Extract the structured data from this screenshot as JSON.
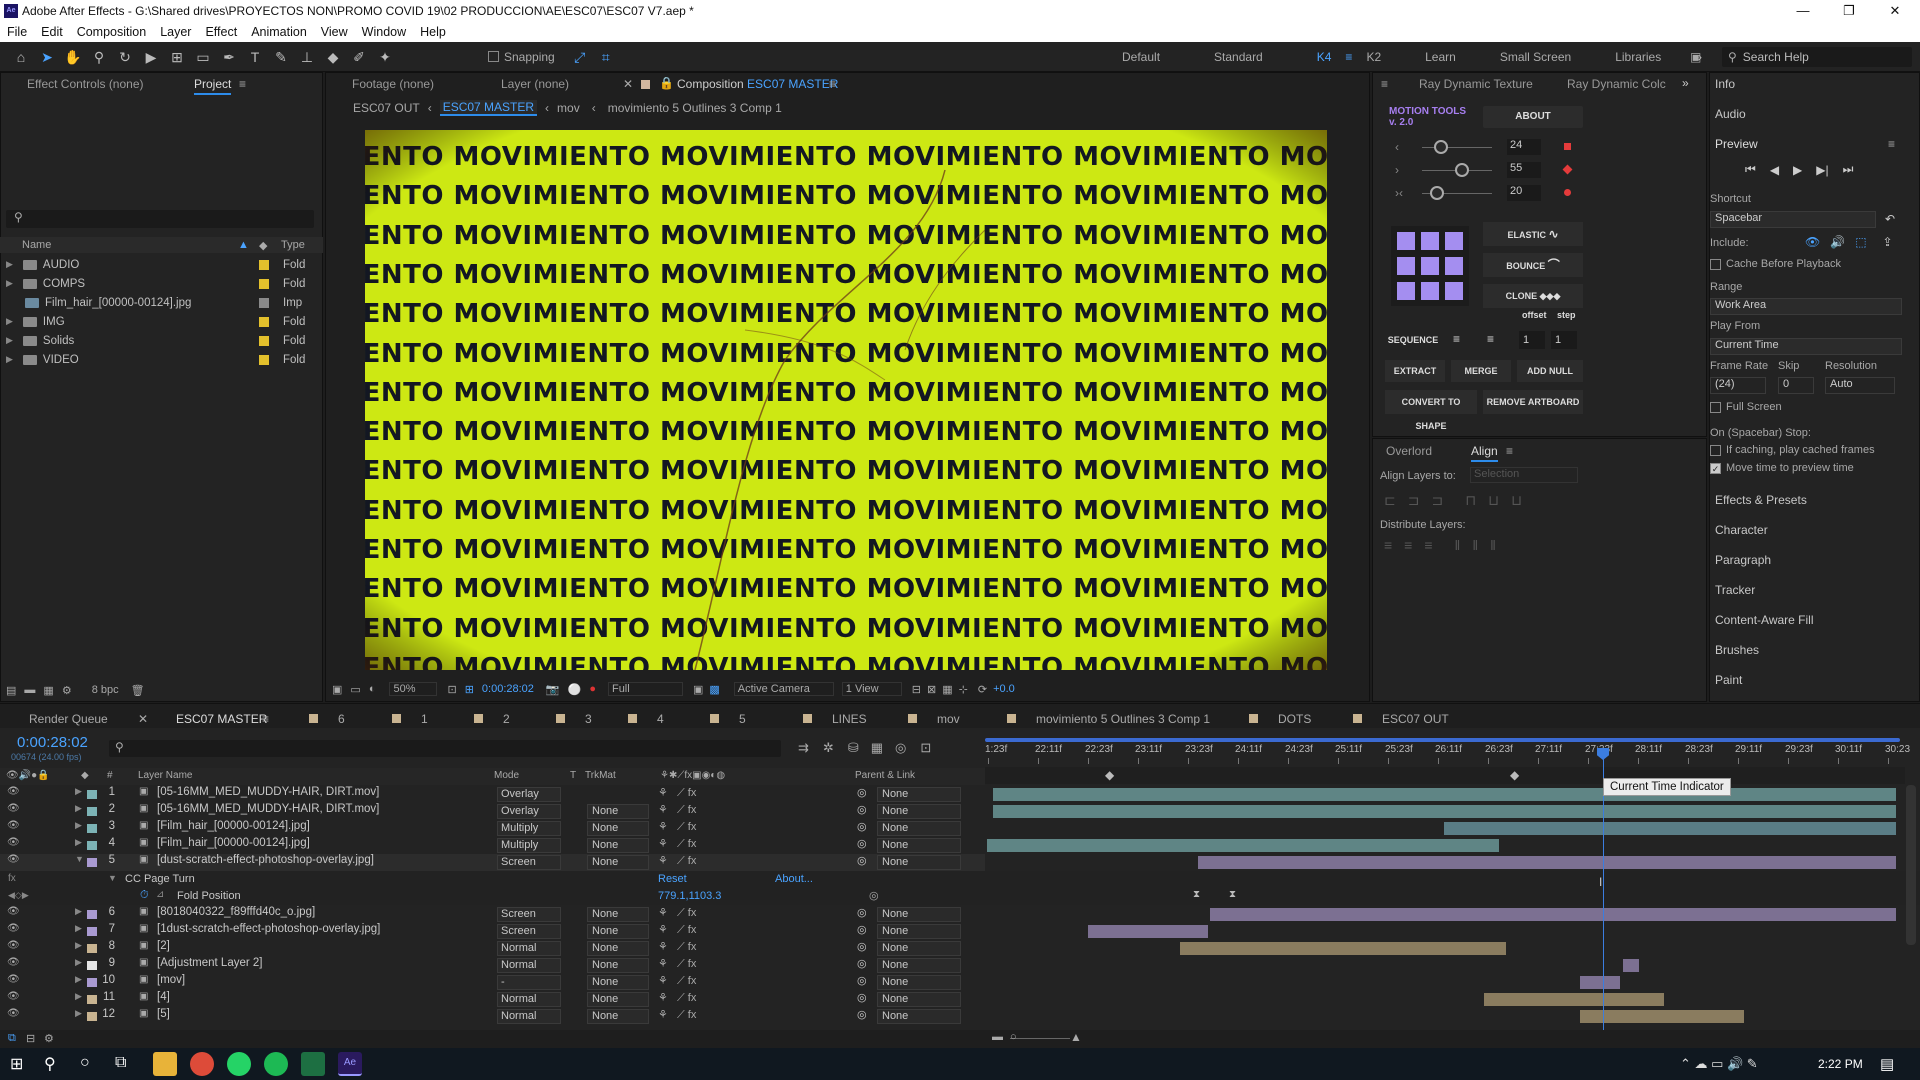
{
  "titlebar": {
    "title": "Adobe After Effects - G:\\Shared drives\\PROYECTOS NON\\PROMO COVID 19\\02 PRODUCCION\\AE\\ESC07\\ESC07 V7.aep *",
    "logo": "Ae"
  },
  "menu": [
    "File",
    "Edit",
    "Composition",
    "Layer",
    "Effect",
    "Animation",
    "View",
    "Window",
    "Help"
  ],
  "toolbar": {
    "snapping": "Snapping",
    "workspaces": [
      "Default",
      "Standard",
      "K4",
      "K2",
      "Learn",
      "Small Screen",
      "Libraries"
    ],
    "search": "Search Help"
  },
  "left_panel": {
    "tabs": [
      "Effect Controls (none)",
      "Project"
    ],
    "columns": [
      "Name",
      "Type"
    ],
    "items": [
      {
        "name": "AUDIO",
        "type": "Fold"
      },
      {
        "name": "COMPS",
        "type": "Fold"
      },
      {
        "name": "Film_hair_[00000-00124].jpg",
        "type": "Imp"
      },
      {
        "name": "IMG",
        "type": "Fold"
      },
      {
        "name": "Solids",
        "type": "Fold"
      },
      {
        "name": "VIDEO",
        "type": "Fold"
      }
    ],
    "bpc": "8 bpc"
  },
  "viewer": {
    "tabs": [
      "Footage (none)",
      "Layer (none)",
      "Composition ESC07 MASTER"
    ],
    "breadcrumbs": [
      "ESC07 OUT",
      "ESC07 MASTER",
      "mov",
      "movimiento 5 Outlines 3 Comp 1"
    ],
    "word": "MOVIMIENTO",
    "zoom": "50%",
    "timecode": "0:00:28:02",
    "resolution": "Full",
    "camera": "Active Camera",
    "view": "1 View",
    "exposure": "+0.0"
  },
  "motion_tools": {
    "tabs": [
      "Ray Dynamic Texture",
      "Ray Dynamic Colc"
    ],
    "title": "MOTION TOOLS v. 2.0",
    "about": "ABOUT",
    "values": [
      "24",
      "55",
      "20"
    ],
    "buttons": [
      "ELASTIC",
      "BOUNCE",
      "CLONE",
      "SEQUENCE",
      "EXTRACT",
      "MERGE",
      "ADD NULL",
      "CONVERT TO SHAPE",
      "REMOVE ARTBOARD"
    ],
    "offset": "offset",
    "step": "step",
    "offset_val": "1",
    "step_val": "1"
  },
  "align": {
    "tabs": [
      "Overlord",
      "Align"
    ],
    "align_to": "Align Layers to:",
    "selection": "Selection",
    "distribute": "Distribute Layers:"
  },
  "right_panel": {
    "info": "Info",
    "audio": "Audio",
    "preview": "Preview",
    "shortcut_label": "Shortcut",
    "shortcut": "Spacebar",
    "include": "Include:",
    "cache": "Cache Before Playback",
    "range_label": "Range",
    "range": "Work Area",
    "play_from_label": "Play From",
    "play_from": "Current Time",
    "frame_rate": "Frame Rate",
    "skip": "Skip",
    "resolution": "Resolution",
    "fr_val": "(24)",
    "skip_val": "0",
    "res_val": "Auto",
    "full_screen": "Full Screen",
    "stop_label": "On (Spacebar) Stop:",
    "if_caching": "If caching, play cached frames",
    "move_time": "Move time to preview time",
    "links": [
      "Effects & Presets",
      "Character",
      "Paragraph",
      "Tracker",
      "Content-Aware Fill",
      "Brushes",
      "Paint"
    ]
  },
  "timeline": {
    "tabs": [
      "Render Queue",
      "ESC07 MASTER",
      "6",
      "1",
      "2",
      "3",
      "4",
      "5",
      "LINES",
      "mov",
      "movimiento 5 Outlines 3 Comp 1",
      "DOTS",
      "ESC07 OUT"
    ],
    "timecode": "0:00:28:02",
    "frames": "00674 (24.00 fps)",
    "headers": [
      "Layer Name",
      "Mode",
      "T",
      "TrkMat",
      "Parent & Link"
    ],
    "ruler": [
      "1:23f",
      "22:11f",
      "22:23f",
      "23:11f",
      "23:23f",
      "24:11f",
      "24:23f",
      "25:11f",
      "25:23f",
      "26:11f",
      "26:23f",
      "27:11f",
      "27:23f",
      "28:11f",
      "28:23f",
      "29:11f",
      "29:23f",
      "30:11f",
      "30:23"
    ],
    "tooltip": "Current Time Indicator",
    "layers": [
      {
        "n": "1",
        "name": "[05-16MM_MED_MUDDY-HAIR, DIRT.mov]",
        "mode": "Overlay",
        "trk": "",
        "parent": "None",
        "color": "#7cb3b5"
      },
      {
        "n": "2",
        "name": "[05-16MM_MED_MUDDY-HAIR, DIRT.mov]",
        "mode": "Overlay",
        "trk": "None",
        "parent": "None",
        "color": "#7cb3b5"
      },
      {
        "n": "3",
        "name": "[Film_hair_[00000-00124].jpg]",
        "mode": "Multiply",
        "trk": "None",
        "parent": "None",
        "color": "#7cb3b5"
      },
      {
        "n": "4",
        "name": "[Film_hair_[00000-00124].jpg]",
        "mode": "Multiply",
        "trk": "None",
        "parent": "None",
        "color": "#7cb3b5"
      },
      {
        "n": "5",
        "name": "[dust-scratch-effect-photoshop-overlay.jpg]",
        "mode": "Screen",
        "trk": "None",
        "parent": "None",
        "color": "#a99ad1"
      }
    ],
    "effect": {
      "name": "CC Page Turn",
      "reset": "Reset",
      "about": "About...",
      "prop": "Fold Position",
      "value": "779.1,1103.3"
    },
    "layers2": [
      {
        "n": "6",
        "name": "[8018040322_f89fffd40c_o.jpg]",
        "mode": "Screen",
        "trk": "None",
        "parent": "None",
        "color": "#a99ad1"
      },
      {
        "n": "7",
        "name": "[1dust-scratch-effect-photoshop-overlay.jpg]",
        "mode": "Screen",
        "trk": "None",
        "parent": "None",
        "color": "#a99ad1"
      },
      {
        "n": "8",
        "name": "[2]",
        "mode": "Normal",
        "trk": "None",
        "parent": "None",
        "color": "#c9b491"
      },
      {
        "n": "9",
        "name": "[Adjustment Layer 2]",
        "mode": "Normal",
        "trk": "None",
        "parent": "None",
        "color": "#e6e6e6"
      },
      {
        "n": "10",
        "name": "[mov]",
        "mode": "-",
        "trk": "None",
        "parent": "None",
        "color": "#a99ad1"
      },
      {
        "n": "11",
        "name": "[4]",
        "mode": "Normal",
        "trk": "None",
        "parent": "None",
        "color": "#c9b491"
      },
      {
        "n": "12",
        "name": "[5]",
        "mode": "Normal",
        "trk": "None",
        "parent": "None",
        "color": "#c9b491"
      }
    ]
  },
  "taskbar": {
    "time": "2:22 PM"
  }
}
